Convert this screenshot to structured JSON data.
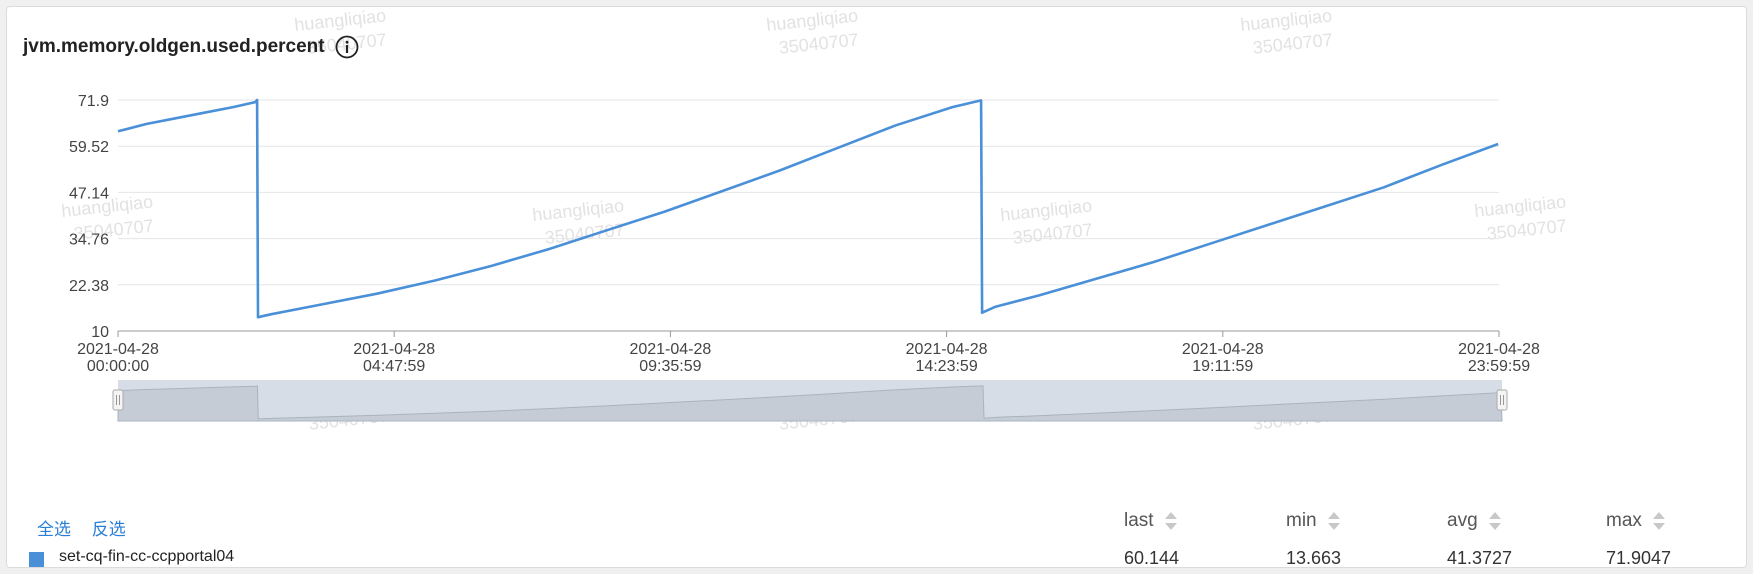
{
  "title": "jvm.memory.oldgen.used.percent",
  "icons": {
    "info": "info-icon",
    "sort": "sort-arrows-icon",
    "handle": "drag-handle-icon"
  },
  "colors": {
    "series": "#4a90d9",
    "link": "#2a7fd4",
    "navigator_fill": "#d6dde6"
  },
  "watermark": [
    "huangliqiao",
    "35040707"
  ],
  "chart_data": {
    "type": "line",
    "x_unit": "time",
    "ylim": [
      10,
      71.9
    ],
    "y_ticks": [
      "71.9",
      "59.52",
      "47.14",
      "34.76",
      "22.38",
      "10"
    ],
    "y_tick_values": [
      71.9,
      59.52,
      47.14,
      34.76,
      22.38,
      10
    ],
    "xlim": [
      "2021-04-28 00:00:00",
      "2021-04-28 23:59:59"
    ],
    "x_ticks": [
      {
        "date": "2021-04-28",
        "time": "00:00:00"
      },
      {
        "date": "2021-04-28",
        "time": "04:47:59"
      },
      {
        "date": "2021-04-28",
        "time": "09:35:59"
      },
      {
        "date": "2021-04-28",
        "time": "14:23:59"
      },
      {
        "date": "2021-04-28",
        "time": "19:11:59"
      },
      {
        "date": "2021-04-28",
        "time": "23:59:59"
      }
    ],
    "grid": "horizontal",
    "series": [
      {
        "name": "set-cq-fin-cc-ccpportal04",
        "points": [
          [
            "00:00",
            63.5
          ],
          [
            "00:30",
            65.5
          ],
          [
            "01:00",
            67.0
          ],
          [
            "01:30",
            68.5
          ],
          [
            "02:00",
            70.0
          ],
          [
            "02:23",
            71.3
          ],
          [
            "02:25",
            71.9
          ],
          [
            "02:26",
            13.7
          ],
          [
            "02:40",
            14.5
          ],
          [
            "03:30",
            17.0
          ],
          [
            "04:30",
            20.0
          ],
          [
            "05:30",
            23.5
          ],
          [
            "06:30",
            27.5
          ],
          [
            "07:30",
            32.0
          ],
          [
            "08:30",
            37.0
          ],
          [
            "09:30",
            42.0
          ],
          [
            "10:30",
            47.5
          ],
          [
            "11:30",
            53.0
          ],
          [
            "12:30",
            59.0
          ],
          [
            "13:30",
            65.0
          ],
          [
            "14:30",
            70.0
          ],
          [
            "15:00",
            71.8
          ],
          [
            "15:01",
            14.9
          ],
          [
            "15:15",
            16.5
          ],
          [
            "16:00",
            19.5
          ],
          [
            "17:00",
            24.0
          ],
          [
            "18:00",
            28.5
          ],
          [
            "19:00",
            33.5
          ],
          [
            "20:00",
            38.5
          ],
          [
            "21:00",
            43.5
          ],
          [
            "22:00",
            48.5
          ],
          [
            "23:00",
            54.5
          ],
          [
            "23:59",
            60.1
          ]
        ]
      }
    ]
  },
  "legend": {
    "select_all": "全选",
    "invert_selection": "反选",
    "columns": [
      "last",
      "min",
      "avg",
      "max"
    ],
    "rows": [
      {
        "name": "set-cq-fin-cc-ccpportal04",
        "last": "60.144",
        "min": "13.663",
        "avg": "41.3727",
        "max": "71.9047"
      }
    ]
  }
}
